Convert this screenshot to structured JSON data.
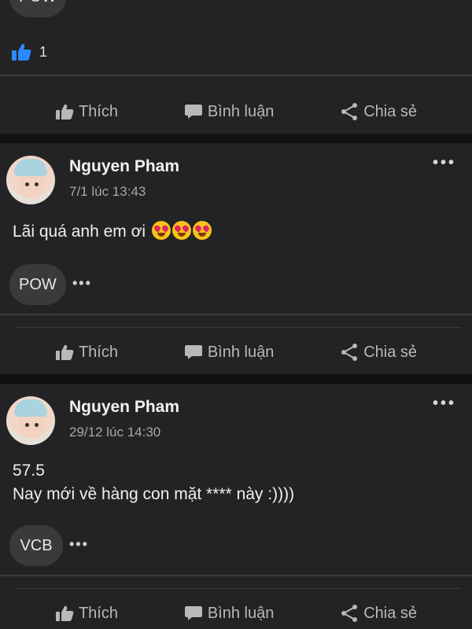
{
  "top_card": {
    "tag": "POW",
    "like_count": "1"
  },
  "actions": {
    "like": "Thích",
    "comment": "Bình luận",
    "share": "Chia sẻ"
  },
  "posts": [
    {
      "author": "Nguyen Pham",
      "timestamp": "7/1 lúc 13:43",
      "body_line1": "Lãi quá anh em ơi",
      "emoji": "heart-eyes",
      "tag": "POW"
    },
    {
      "author": "Nguyen Pham",
      "timestamp": "29/12 lúc 14:30",
      "body_line1": "57.5",
      "body_line2": "Nay mới về hàng con mặt **** này :))))",
      "tag": "VCB"
    }
  ],
  "colors": {
    "background": "#111112",
    "card": "#232325",
    "like_blue": "#2d88ff",
    "action_text": "#b8b8b8"
  }
}
